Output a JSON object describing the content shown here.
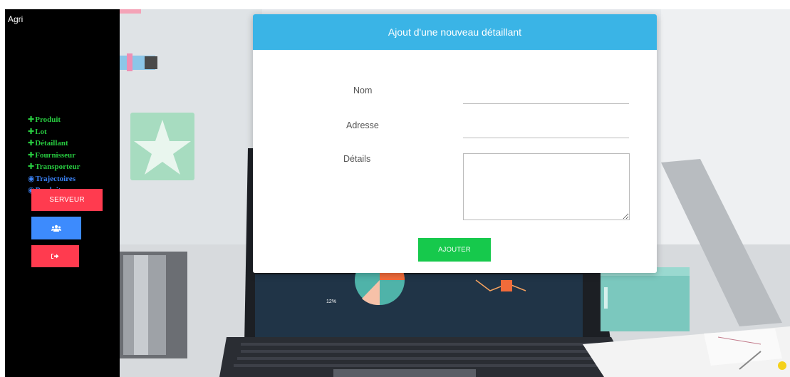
{
  "sidebar": {
    "brand": "Agri",
    "items": [
      {
        "label": "Produit",
        "icon": "plus-icon",
        "color": "#27c93f"
      },
      {
        "label": "Lot",
        "icon": "plus-icon",
        "color": "#27c93f"
      },
      {
        "label": "Détaillant",
        "icon": "plus-icon",
        "color": "#27c93f"
      },
      {
        "label": "Fournisseur",
        "icon": "plus-icon",
        "color": "#27c93f"
      },
      {
        "label": "Transporteur",
        "icon": "plus-icon",
        "color": "#27c93f"
      },
      {
        "label": "Trajectoires",
        "icon": "eye-icon",
        "color": "#3b82f6"
      },
      {
        "label": "Produit",
        "icon": "eye-icon",
        "color": "#3b82f6"
      }
    ],
    "server_button": "SERVEUR",
    "users_button_icon": "users-icon",
    "logout_button_icon": "sign-out-icon"
  },
  "modal": {
    "title": "Ajout d'une nouveau détaillant",
    "fields": {
      "nom_label": "Nom",
      "nom_value": "",
      "adresse_label": "Adresse",
      "adresse_value": "",
      "details_label": "Détails",
      "details_value": ""
    },
    "submit": "AJOUTER"
  },
  "background": {
    "chart_label": "12%"
  },
  "colors": {
    "header": "#3ab4e6",
    "submit": "#16c94c",
    "danger": "#ff3b4f",
    "primary": "#3d8bfd"
  }
}
